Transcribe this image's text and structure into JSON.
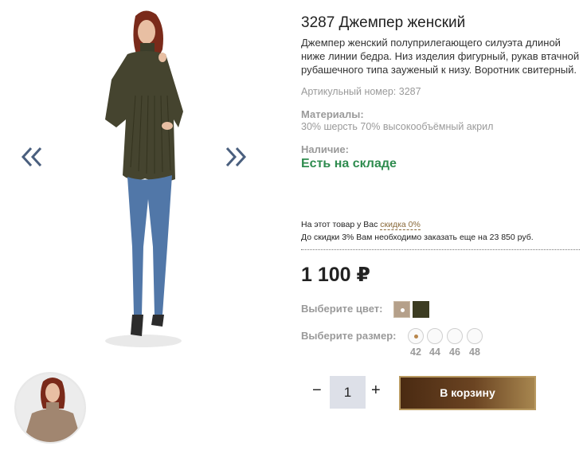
{
  "gallery": {
    "prev_icon": "chevron-double-left-icon",
    "next_icon": "chevron-double-right-icon",
    "arrow_color": "#4a5f7e"
  },
  "product": {
    "title": "3287 Джемпер женский",
    "description": "Джемпер женский полуприлегающего силуэта длиной ниже линии бедра. Низ изделия фигурный, рукав втачной рубашечного типа зауженый к низу. Воротник свитерный.",
    "article": "Артикульный номер: 3287",
    "materials_label": "Материалы:",
    "materials_value": "30% шерсть 70% высокообъёмный акрил",
    "availability_label": "Наличие:",
    "availability_value": "Есть на складе",
    "availability_color": "#2f8c4f"
  },
  "discount": {
    "line1_prefix": "На этот товар у Вас ",
    "line1_link": "скидка 0%",
    "line2": "До скидки 3% Вам необходимо заказать еще на 23 850 руб."
  },
  "price": {
    "value": "1 100 ₽"
  },
  "colors": {
    "label": "Выберите цвет:",
    "options": [
      {
        "hex": "#b5a08a",
        "selected": true
      },
      {
        "hex": "#3c3c22",
        "selected": false
      }
    ]
  },
  "sizes": {
    "label": "Выберите размер:",
    "options": [
      "42",
      "44",
      "46",
      "48"
    ],
    "selected": "42"
  },
  "cart": {
    "quantity": "1",
    "minus": "−",
    "plus": "+",
    "button_label": "В корзину"
  }
}
